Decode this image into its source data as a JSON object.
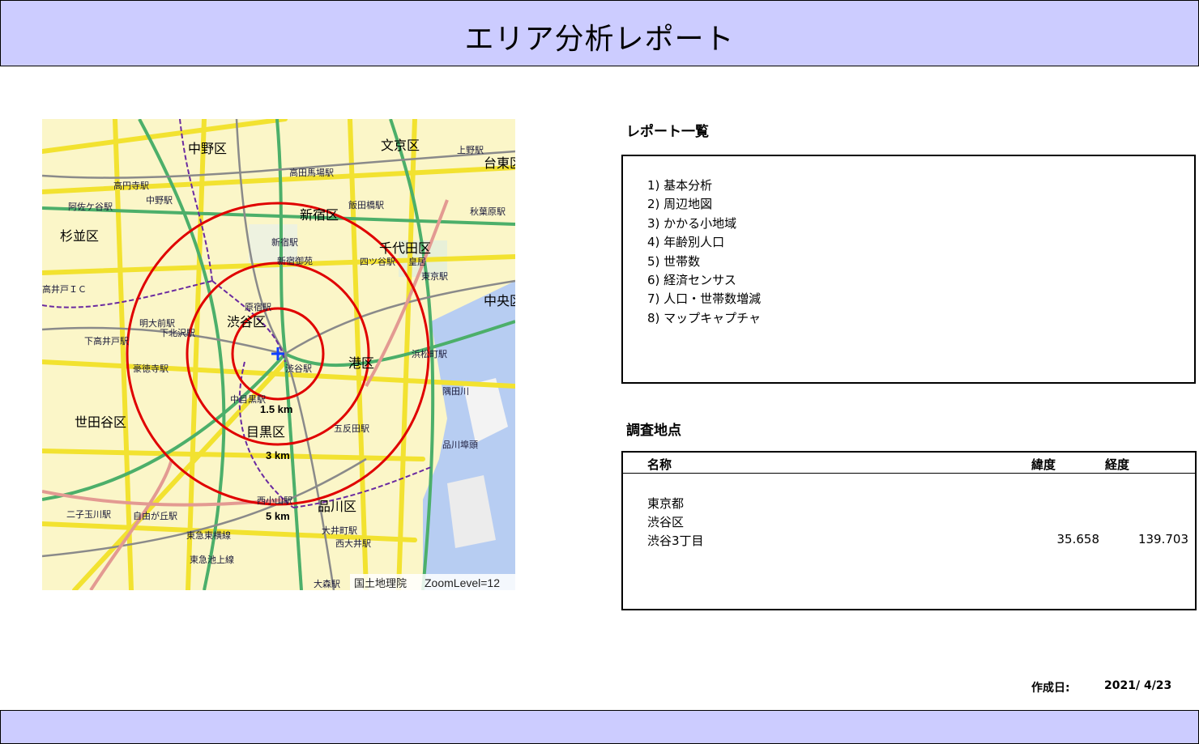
{
  "title": "エリア分析レポート",
  "map": {
    "attribution": "国土地理院",
    "zoom_text": "ZoomLevel=12",
    "rings": [
      "1.5 km",
      "3 km",
      "5 km"
    ],
    "labels": {
      "nakano": "中野区",
      "bunkyo": "文京区",
      "shinjuku": "新宿区",
      "suginami": "杉並区",
      "chiyoda": "千代田区",
      "shibuya": "渋谷区",
      "minato": "港区",
      "setagaya": "世田谷区",
      "meguro": "目黒区",
      "shinagawa": "品川区",
      "chuo": "中央区",
      "taito": "台東区",
      "shinjuku_st": "新宿駅",
      "shinjuku_gyoen": "新宿御苑",
      "koenji_st": "高円寺駅",
      "asagaya_st": "阿佐ケ谷駅",
      "nakano_st": "中野駅",
      "takadanobaba_st": "高田馬場駅",
      "iidabashi_st": "飯田橋駅",
      "shimokitazawa_st": "下北沢駅",
      "gotokuji_st": "豪徳寺駅",
      "nakameguro_st": "中目黒駅",
      "jiyugaoka_st": "自由が丘駅",
      "futakotamagawa_st": "二子玉川駅",
      "oimachi_st": "大井町駅",
      "omori_st": "大森駅",
      "hamamatsucho_st": "浜松町駅",
      "shinagawa_wharf": "品川埠頭",
      "shibuya_st": "渋谷駅",
      "yotsuya": "四ツ谷駅",
      "kokyo": "皇居",
      "tokyo_st": "東京駅",
      "harajuku_st": "原宿駅",
      "meidaimae_st": "明大前駅",
      "shimotakaido_st": "下高井戸駅",
      "gotanda_st": "五反田駅",
      "ueno_st": "上野駅",
      "akihabara_st": "秋葉原駅",
      "sumida": "隅田川",
      "tokyu_toyoko": "東急東横線",
      "tokyu_ikegami": "東急池上線",
      "nishiooi_st": "西大井駅",
      "takaido_ic": "高井戸ＩＣ",
      "hazamacho": "西小山駅"
    }
  },
  "report": {
    "heading": "レポート一覧",
    "items": [
      "1) 基本分析",
      "2) 周辺地図",
      "3) かかる小地域",
      "4) 年齢別人口",
      "5) 世帯数",
      "6) 経済センサス",
      "7) 人口・世帯数増減",
      "8) マップキャプチャ"
    ]
  },
  "survey": {
    "heading": "調査地点",
    "columns": {
      "name": "名称",
      "lat": "緯度",
      "lon": "経度"
    },
    "rows": [
      {
        "name": "東京都",
        "lat": "",
        "lon": ""
      },
      {
        "name": "渋谷区",
        "lat": "",
        "lon": ""
      },
      {
        "name": "渋谷3丁目",
        "lat": "35.658",
        "lon": "139.703"
      }
    ]
  },
  "footer": {
    "created_label": "作成日:",
    "created_date": "2021/ 4/23"
  },
  "colors": {
    "band": "#ccccff",
    "ring": "#e00000",
    "marker": "#1040ff"
  }
}
